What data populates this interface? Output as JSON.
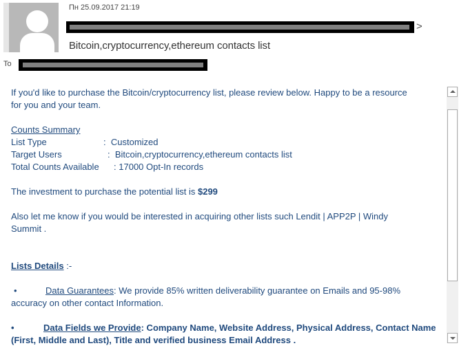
{
  "header": {
    "date": "Пн 25.09.2017 21:19",
    "sender_suffix": ">",
    "subject": "Bitcoin,cryptocurrency,ethereum contacts list",
    "to_label": "To"
  },
  "body": {
    "intro_line1": "If you'd like to purchase the Bitcoin/cryptocurrency list, please review below. Happy to be a resource",
    "intro_line2": "for you and your team.",
    "counts_heading": "Counts Summary",
    "counts": [
      {
        "label": "List Type",
        "sep": ":",
        "value": "Customized"
      },
      {
        "label": "Target Users",
        "sep": ":",
        "value": "Bitcoin,cryptocurrency,ethereum contacts list"
      },
      {
        "label": "Total Counts Available",
        "sep": ":",
        "value": "17000 Opt-In records"
      }
    ],
    "investment_text": "The investment to purchase the potential  list is ",
    "investment_price": "$299",
    "other_lists_line1": "Also let me know if you would be interested in acquiring other lists such Lendit | APP2P |  Windy",
    "other_lists_line2": "Summit .",
    "details_heading": "Lists Details",
    "details_suffix": " :-",
    "bullets": [
      {
        "marker": "•",
        "title": "Data Guarantees",
        "text_line1": ": We provide 85% written deliverability guarantee on Emails and 95-98%",
        "text_line2": "accuracy on other contact Information."
      },
      {
        "marker": "•",
        "title": "Data Fields we Provide",
        "text_line1": ": Company Name, Website Address, Physical Address, Contact Name",
        "text_line2": "(First, Middle and Last), Title and verified business Email Address ."
      }
    ]
  }
}
